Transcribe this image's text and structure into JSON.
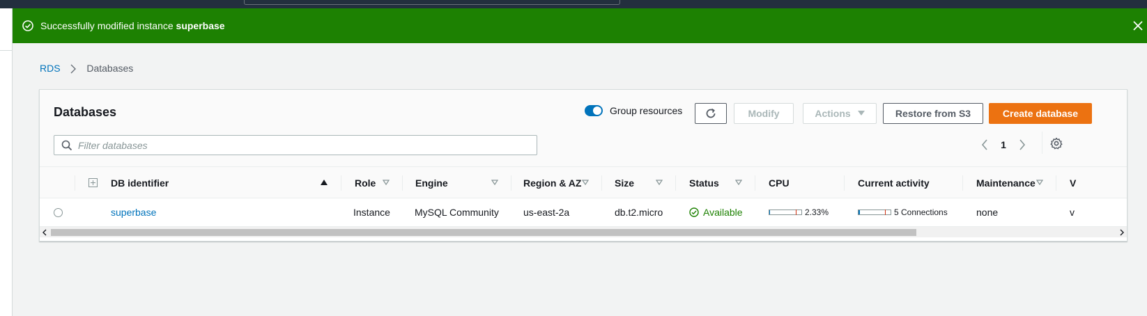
{
  "flash": {
    "message_prefix": "Successfully modified instance ",
    "instance_name": "superbase",
    "color": "#1d8102"
  },
  "breadcrumb": {
    "root": "RDS",
    "current": "Databases"
  },
  "panel": {
    "title": "Databases",
    "group_resources_label": "Group resources",
    "group_resources_on": true,
    "buttons": {
      "modify": "Modify",
      "actions": "Actions",
      "restore": "Restore from S3",
      "create": "Create database"
    },
    "filter_placeholder": "Filter databases",
    "page_number": "1"
  },
  "table": {
    "columns": [
      "DB identifier",
      "Role",
      "Engine",
      "Region & AZ",
      "Size",
      "Status",
      "CPU",
      "Current activity",
      "Maintenance",
      "V"
    ],
    "rows": [
      {
        "db_identifier": "superbase",
        "role": "Instance",
        "engine": "MySQL Community",
        "region_az": "us-east-2a",
        "size": "db.t2.micro",
        "status": "Available",
        "cpu": "2.33%",
        "cpu_fraction": 0.0233,
        "activity": "5 Connections",
        "activity_fraction": 0.05,
        "maintenance": "none",
        "vpc": "v"
      }
    ]
  },
  "colors": {
    "link": "#0073bb",
    "primary_button": "#ec7211",
    "top_bar": "#232f3e",
    "status_ok": "#1d8102"
  },
  "icons": [
    "success-check-icon",
    "close-icon",
    "chevron-right-icon",
    "refresh-icon",
    "caret-down-icon",
    "search-icon",
    "chevron-left-icon",
    "settings-gear-icon",
    "sort-ascending-icon",
    "sort-descending-icon"
  ]
}
